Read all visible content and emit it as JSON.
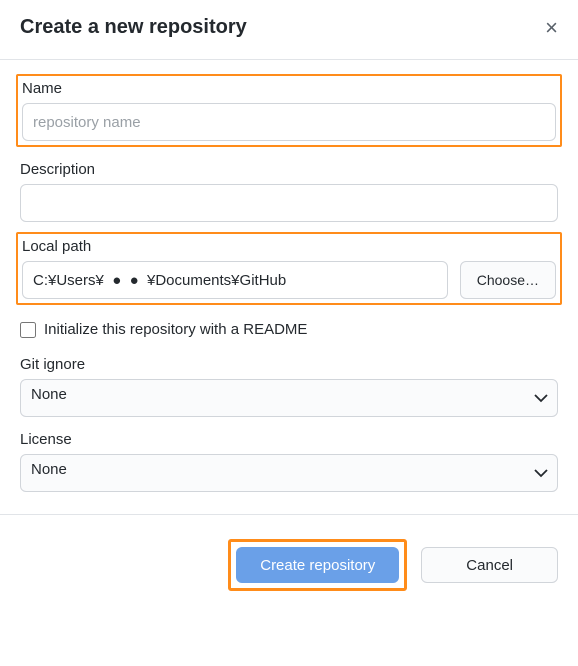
{
  "header": {
    "title": "Create a new repository"
  },
  "fields": {
    "name": {
      "label": "Name",
      "placeholder": "repository name",
      "value": ""
    },
    "description": {
      "label": "Description",
      "value": ""
    },
    "local_path": {
      "label": "Local path",
      "value": "C:¥Users¥  ●  ●  ¥Documents¥GitHub",
      "choose_label": "Choose…"
    },
    "readme": {
      "label": "Initialize this repository with a README",
      "checked": false
    },
    "git_ignore": {
      "label": "Git ignore",
      "selected": "None"
    },
    "license": {
      "label": "License",
      "selected": "None"
    }
  },
  "footer": {
    "create_label": "Create repository",
    "cancel_label": "Cancel"
  }
}
